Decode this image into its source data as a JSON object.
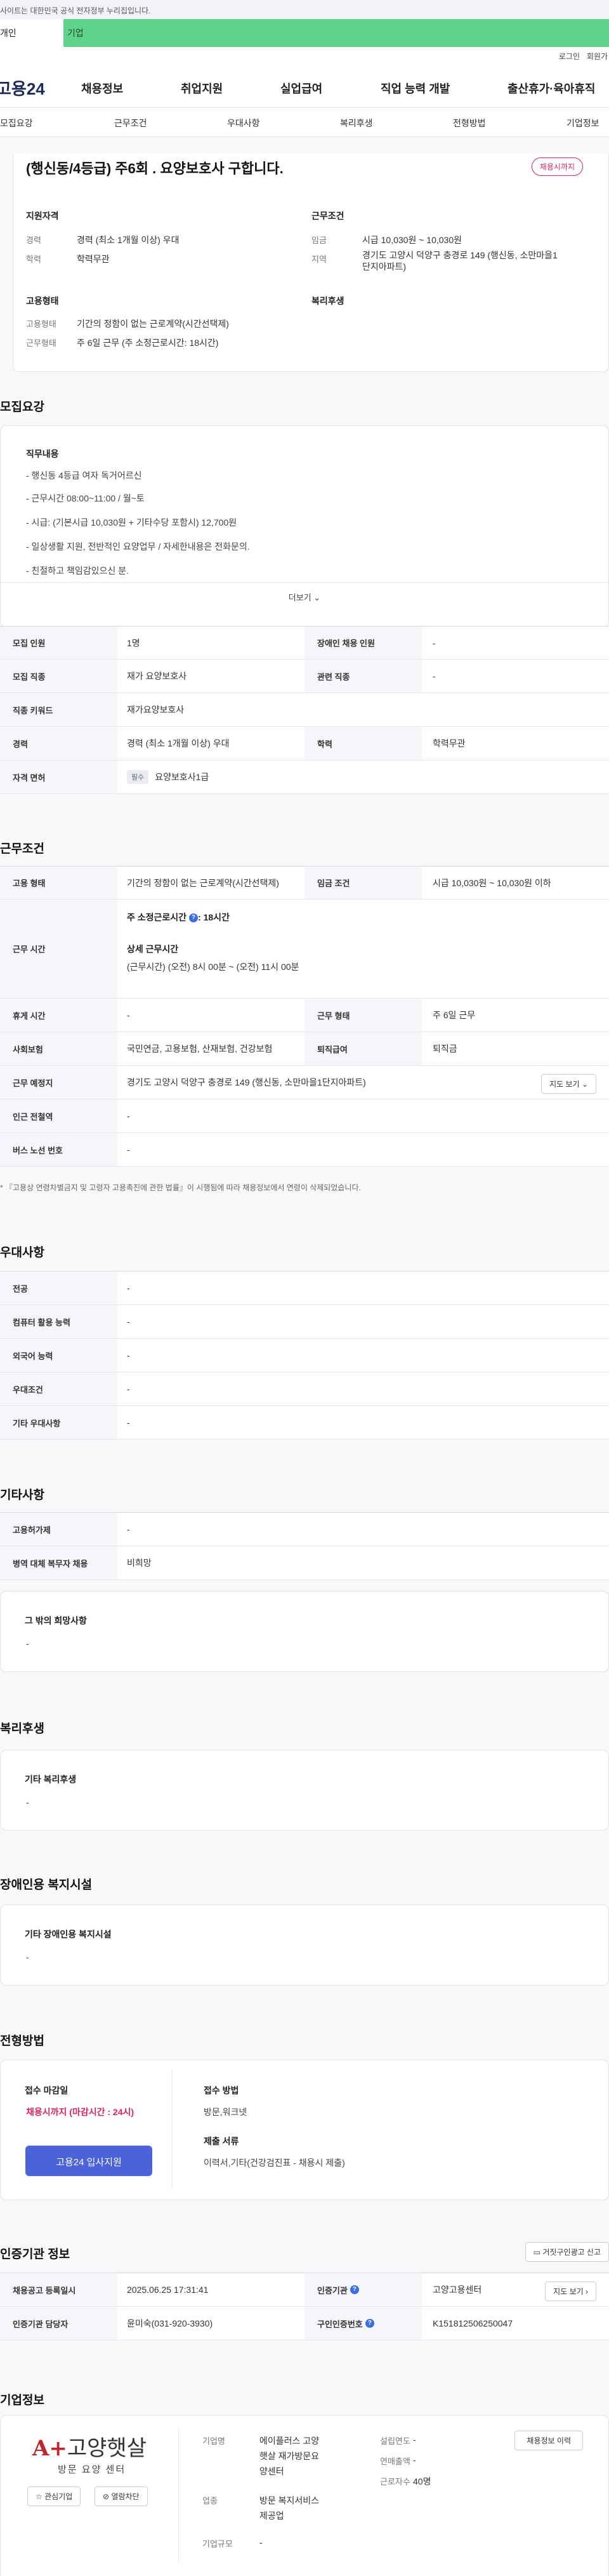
{
  "gov_banner": "사이트는 대한민국 공식 전자정부 누리집입니다.",
  "user_tabs": [
    "개인",
    "기업"
  ],
  "utility": {
    "login": "로그인",
    "join": "회원가"
  },
  "gnb": {
    "logo": "고용24",
    "menu": [
      "채용정보",
      "취업지원",
      "실업급여",
      "직업 능력 개발",
      "출산휴가·육아휴직"
    ]
  },
  "subnav": [
    "모집요강",
    "근무조건",
    "우대사항",
    "복리후생",
    "전형방법",
    "기업정보"
  ],
  "title_card": {
    "title": "(행신동/4등급) 주6회 . 요양보호사 구합니다.",
    "deadline_badge": "채용시까지",
    "qual_label": "지원자격",
    "career_k": "경력",
    "career_v": "경력 (최소 1개월 이상) 우대",
    "edu_k": "학력",
    "edu_v": "학력무관",
    "cond_label": "근무조건",
    "wage_k": "임금",
    "wage_v": "시급 10,030원 ~ 10,030원",
    "region_k": "지역",
    "region_v1": "경기도 고양시 덕양구 충경로 149 (행신동, 소만마을1",
    "region_v2": "단지아파트)",
    "emp_label": "고용형태",
    "emptype_k": "고용형태",
    "emptype_v": "기간의 정함이 없는 근로계약(시간선택제)",
    "worktype_k": "근무형태",
    "worktype_v": "주 6일 근무 (주 소정근로시간: 18시간)",
    "welfare_label": "복리후생"
  },
  "recruit": {
    "section_title": "모집요강",
    "duty_label": "직무내용",
    "duty_lines": [
      "-  행신동 4등급 여자 독거어르신",
      "-  근무시간 08:00~11:00 / 월~토",
      "-  시급: (기본시급 10,030원 + 기타수당 포함시) 12,700원",
      "-  일상생활 지원, 전반적인 요양업무 / 자세한내용은 전화문의.",
      "-  친절하고 책임감있으신 분."
    ],
    "more": "더보기",
    "table": {
      "headcount_k": "모집 인원",
      "headcount_v": "1명",
      "disabled_k": "장애인 채용 인원",
      "disabled_v": "-",
      "job_k": "모집 직종",
      "job_v": "재가 요양보호사",
      "rel_k": "관련 직종",
      "rel_v": "-",
      "keyword_k": "직종 키워드",
      "keyword_v": "재가요양보호사",
      "career_k": "경력",
      "career_v": "경력 (최소 1개월 이상) 우대",
      "edu_k": "학력",
      "edu_v": "학력무관",
      "license_k": "자격 면허",
      "license_tag": "필수",
      "license_v": "요양보호사1급"
    }
  },
  "conditions": {
    "section_title": "근무조건",
    "emptype_k": "고용 형태",
    "emptype_v": "기간의 정함이 없는 근로계약(시간선택제)",
    "wage_k": "임금 조건",
    "wage_v": "시급 10,030원 ~ 10,030원 이하",
    "hours_k": "근무 시간",
    "hours_weekly_label": "주 소정근로시간",
    "hours_weekly_v": ": 18시간",
    "hours_detail_label": "상세 근무시간",
    "hours_detail_v": "(근무시간) (오전) 8시 00분 ~ (오전) 11시 00분",
    "break_k": "휴게 시간",
    "break_v": "-",
    "worktype_k": "근무 형태",
    "worktype_v": "주 6일 근무",
    "insurance_k": "사회보험",
    "insurance_v": "국민연금, 고용보험, 산재보험, 건강보험",
    "retire_k": "퇴직급여",
    "retire_v": "퇴직금",
    "place_k": "근무 예정지",
    "place_v": "경기도 고양시 덕양구 충경로 149 (행신동, 소만마을1단지아파트)",
    "map_btn": "지도 보기",
    "subway_k": "인근 전철역",
    "subway_v": "-",
    "bus_k": "버스 노선 번호",
    "bus_v": "-",
    "note": "* 『고용상 연령차별금지 및 고령자 고용촉진에 관한 법률』이 시행됨에 따라 채용정보에서 연령이 삭제되었습니다."
  },
  "preferences": {
    "section_title": "우대사항",
    "rows": [
      {
        "k": "전공",
        "v": "-"
      },
      {
        "k": "컴퓨터 활용 능력",
        "v": "-"
      },
      {
        "k": "외국어 능력",
        "v": "-"
      },
      {
        "k": "우대조건",
        "v": "-"
      },
      {
        "k": "기타 우대사항",
        "v": "-"
      }
    ]
  },
  "etc": {
    "section_title": "기타사항",
    "rows": [
      {
        "k": "고용허가제",
        "v": "-"
      },
      {
        "k": "병역 대체 복무자 채용",
        "v": "비희망"
      }
    ],
    "other_label": "그 밖의 희망사항",
    "other_v": "-"
  },
  "welfare": {
    "section_title": "복리후생",
    "label": "기타 복리후생",
    "value": "-"
  },
  "disability": {
    "section_title": "장애인용 복지시설",
    "label": "기타 장애인용 복지시설",
    "value": "-"
  },
  "selection": {
    "section_title": "전형방법",
    "deadline_label": "접수 마감일",
    "deadline_v": "채용시까지 (마감시간 : 24시)",
    "apply_btn": "고용24 입사지원",
    "method_label": "접수 방법",
    "method_v": "방문,워크넷",
    "docs_label": "제출 서류",
    "docs_v": "이력서,기타(건강검진표 - 채용시 제출)"
  },
  "cert": {
    "section_title": "인증기관 정보",
    "report_btn": "거짓구인광고 신고",
    "date_k": "채용공고 등록일시",
    "date_v": "2025.06.25 17:31:41",
    "org_k": "인증기관",
    "org_v": "고양고용센터",
    "map_btn": "지도 보기",
    "manager_k": "인증기관 담당자",
    "manager_v": "윤미숙(031-920-3930)",
    "cert_no_k": "구인인증번호",
    "cert_no_v": "K151812506250047"
  },
  "company": {
    "section_title": "기업정보",
    "logo_plus": "A+",
    "logo_name": "고양햇살",
    "logo_sub": "방문 요양 센터",
    "fav_btn": "관심기업",
    "block_btn": "열람차단",
    "name_k": "기업명",
    "name_v1": "에이플러스 고양",
    "name_v2": "햇살 재가방문요",
    "name_v3": "양센터",
    "industry_k": "업종",
    "industry_v1": "방문 복지서비스",
    "industry_v2": "제공업",
    "scale_k": "기업규모",
    "scale_v": "-",
    "founded_k": "설립연도",
    "founded_v": "-",
    "sales_k": "연매출액",
    "sales_v": "-",
    "employees_k": "근로자수",
    "employees_v": "40명",
    "jobs_btn": "채용정보 이력"
  }
}
